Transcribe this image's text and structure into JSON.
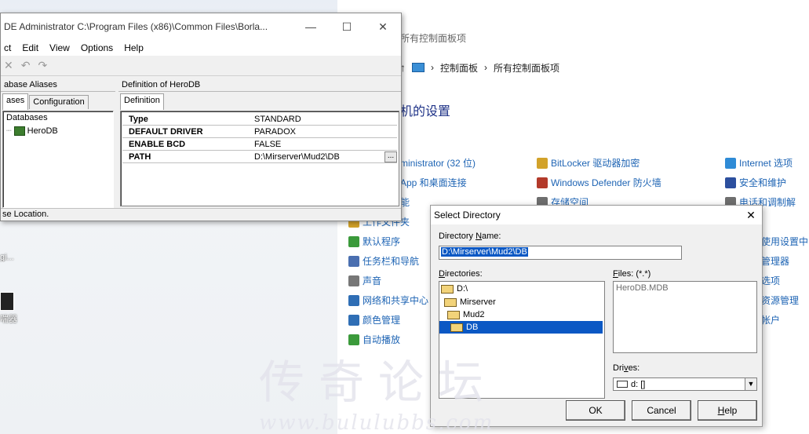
{
  "bde": {
    "title": "DE Administrator  C:\\Program Files (x86)\\Common Files\\Borla...",
    "minimize": "—",
    "maximize": "☐",
    "close": "✕",
    "menu": [
      "ct",
      "Edit",
      "View",
      "Options",
      "Help"
    ],
    "toolbar": [
      "✕",
      "↶",
      "↷"
    ],
    "left_pane_caption": "abase Aliases",
    "tabs": [
      "ases",
      "Configuration"
    ],
    "tree": [
      "Databases",
      "HeroDB"
    ],
    "right_pane_caption": "Definition of HeroDB",
    "right_tab": "Definition",
    "definition": [
      {
        "key": "Type",
        "value": "STANDARD"
      },
      {
        "key": "DEFAULT DRIVER",
        "value": "PARADOX"
      },
      {
        "key": "ENABLE BCD",
        "value": "FALSE"
      },
      {
        "key": "PATH",
        "value": "D:\\Mirserver\\Mud2\\DB"
      }
    ],
    "ellipsis": "...",
    "status": "se Location."
  },
  "control_panel": {
    "title": "所有控制面板项",
    "breadcrumb": [
      "控制面板",
      "所有控制面板项"
    ],
    "heading": "机的设置",
    "items": [
      {
        "label": "ministrator (32 位)",
        "color": "#2f6eb5"
      },
      {
        "label": "App 和桌面连接",
        "color": "#2f6eb5"
      },
      {
        "label": "能",
        "color": "#2f6eb5"
      },
      {
        "label": "BitLocker 驱动器加密",
        "color": "#d2a22a"
      },
      {
        "label": "Windows Defender 防火墙",
        "color": "#b33a2a"
      },
      {
        "label": "存储空间",
        "color": "#6e6e6e"
      },
      {
        "label": "Internet 选项",
        "color": "#2f8bd6"
      },
      {
        "label": "安全和维护",
        "color": "#2c4f9e"
      },
      {
        "label": "电话和调制解",
        "color": "#6e6e6e"
      },
      {
        "label": "工作文件夹",
        "color": "#d2a22a"
      },
      {
        "label": "默认程序",
        "color": "#3b9a3b"
      },
      {
        "label": "任务栏和导航",
        "color": "#4a6fb0"
      },
      {
        "label": "声音",
        "color": "#777777"
      },
      {
        "label": "网络和共享中心",
        "color": "#2f6eb5"
      },
      {
        "label": "颜色管理",
        "color": "#2f6eb5"
      },
      {
        "label": "自动播放",
        "color": "#3b9a3b"
      },
      {
        "label": "使用设置中",
        "color": "#2f6eb5"
      },
      {
        "label": "管理器",
        "color": "#2f6eb5"
      },
      {
        "label": "选项",
        "color": "#2f6eb5"
      },
      {
        "label": "资源管理",
        "color": "#2f6eb5"
      },
      {
        "label": "帐户",
        "color": "#2f6eb5"
      }
    ]
  },
  "desktop_icons": [
    "gi...",
    "喘器"
  ],
  "select_directory": {
    "title": "Select Directory",
    "close": "✕",
    "directory_name_label_u": "N",
    "directory_name_label_pre": "Directory ",
    "directory_name_label_post": "ame:",
    "directory_name_value": "D:\\Mirserver\\Mud2\\DB",
    "directories_label_u": "D",
    "directories_label_post": "irectories:",
    "directories": [
      "D:\\",
      "Mirserver",
      "Mud2",
      "DB"
    ],
    "files_label_u": "F",
    "files_label_post": "iles: (*.*)",
    "files": [
      "HeroDB.MDB"
    ],
    "drives_label_pre": "Dri",
    "drives_label_u": "v",
    "drives_label_post": "es:",
    "drive_value": "d: []",
    "ok": "OK",
    "cancel": "Cancel",
    "help_u": "H",
    "help_post": "elp"
  },
  "watermark": {
    "text": "传奇论坛",
    "url": "www.bululubbs.com"
  },
  "colors": {
    "selection": "#0b58c4",
    "link": "#1e64b4"
  }
}
